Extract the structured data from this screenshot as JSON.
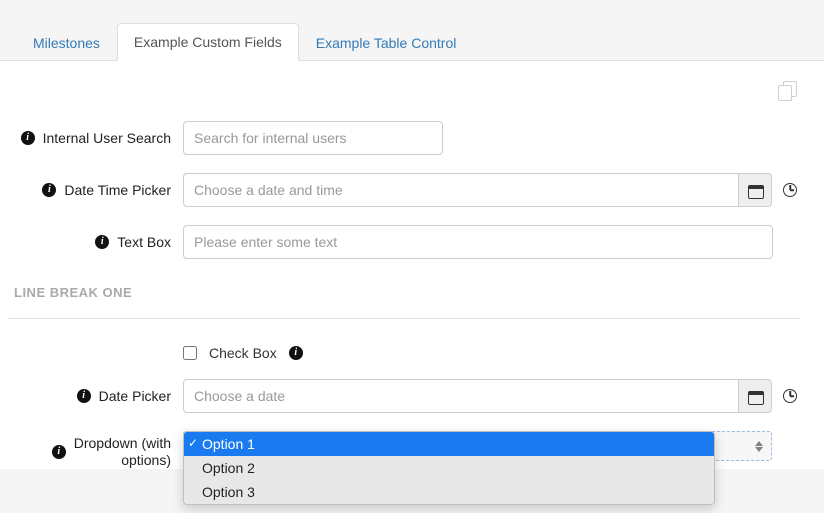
{
  "tabs": {
    "milestones": "Milestones",
    "custom_fields": "Example Custom Fields",
    "table_control": "Example Table Control"
  },
  "fields": {
    "user_search": {
      "label": "Internal User Search",
      "placeholder": "Search for internal users"
    },
    "datetime": {
      "label": "Date Time Picker",
      "placeholder": "Choose a date and time"
    },
    "textbox": {
      "label": "Text Box",
      "placeholder": "Please enter some text"
    },
    "checkbox": {
      "label": "Check Box"
    },
    "datepicker": {
      "label": "Date Picker",
      "placeholder": "Choose a date"
    },
    "dropdown": {
      "label_line1": "Dropdown (with",
      "label_line2": "options)",
      "options": [
        "Option 1",
        "Option 2",
        "Option 3"
      ],
      "selected_index": 0
    }
  },
  "section_break": "LINE BREAK ONE"
}
